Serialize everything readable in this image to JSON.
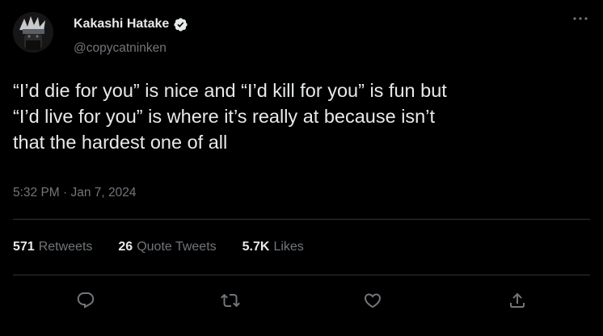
{
  "user": {
    "display_name": "Kakashi Hatake",
    "handle": "@copycatninken",
    "verified": true
  },
  "tweet": {
    "text": "“I’d die for you” is nice and “I’d kill for you” is fun but\n“I’d live for you” is where it’s really at because isn’t\nthat the hardest one of all",
    "timestamp": "5:32 PM · Jan 7, 2024"
  },
  "stats": {
    "retweets_count": "571",
    "retweets_label": "Retweets",
    "quotes_count": "26",
    "quotes_label": "Quote Tweets",
    "likes_count": "5.7K",
    "likes_label": "Likes"
  },
  "colors": {
    "background": "#000000",
    "primary_text": "#e7e9ea",
    "secondary_text": "#71767b",
    "divider": "#2f3336"
  },
  "icons": [
    "verified-badge-icon",
    "more-icon",
    "reply-icon",
    "retweet-icon",
    "like-icon",
    "share-icon"
  ]
}
